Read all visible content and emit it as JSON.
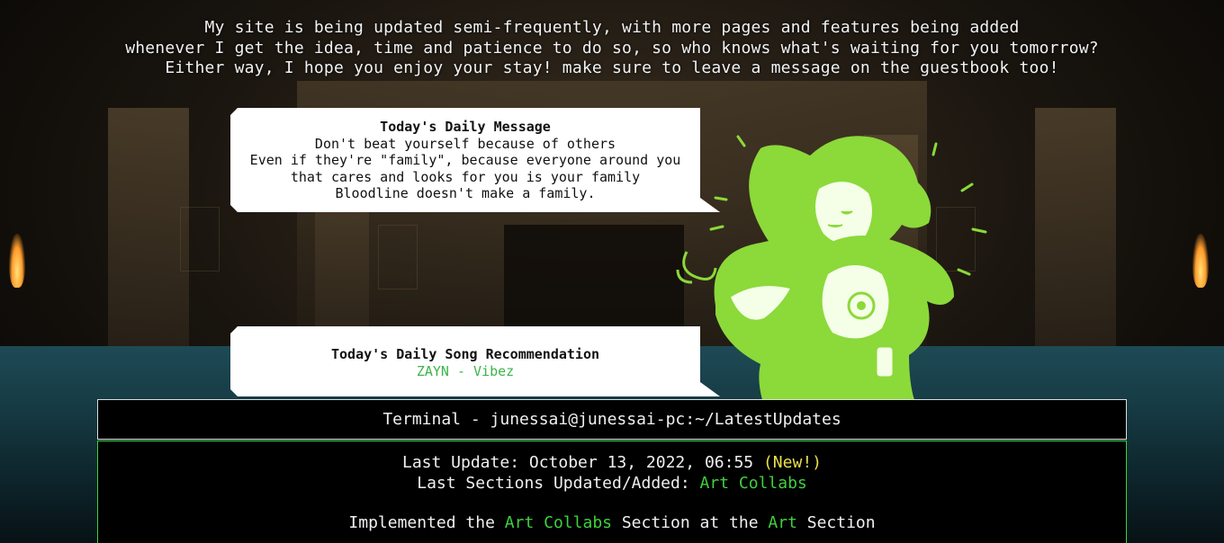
{
  "intro": {
    "line1": "My site is being updated semi-frequently, with more pages and features being added",
    "line2": "whenever I get the idea, time and patience to do so, so who knows what's waiting for you tomorrow?",
    "line3": "Either way, I hope you enjoy your stay! make sure to leave a message on the guestbook too!"
  },
  "daily_message": {
    "title": "Today's Daily Message",
    "lines": [
      "Don't beat yourself because of others",
      "Even if they're \"family\", because everyone around you",
      "that cares and looks for you is your family",
      "Bloodline doesn't make a family."
    ]
  },
  "daily_song": {
    "title": "Today's Daily Song Recommendation",
    "song": "ZAYN - Vibez"
  },
  "terminal": {
    "title": "Terminal - junessai@junessai-pc:~/LatestUpdates",
    "last_update_label": "Last Update: ",
    "last_update_value": "October 13, 2022, 06:55",
    "new_badge": "(New!)",
    "sections_label": "Last Sections Updated/Added: ",
    "sections_value": "Art Collabs",
    "impl_prefix": "Implemented the ",
    "impl_link1": "Art Collabs",
    "impl_middle": " Section at the ",
    "impl_link2": "Art",
    "impl_suffix": " Section"
  },
  "colors": {
    "accent_green": "#3ed13e",
    "art_green": "#8cd93a",
    "new_yellow": "#e8e04a"
  }
}
